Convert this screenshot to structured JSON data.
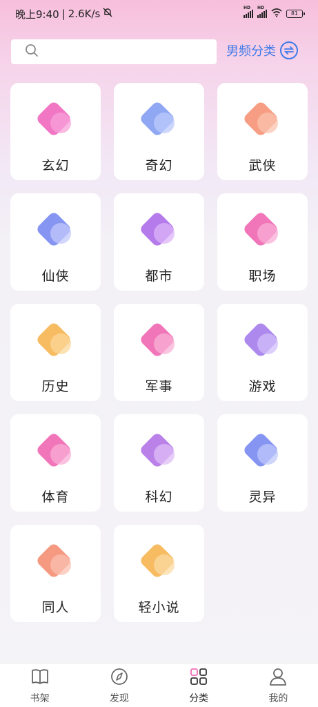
{
  "status_bar": {
    "time": "晚上9:40",
    "network_speed": "2.6K/s",
    "battery": "81",
    "signal_label": "HD"
  },
  "search": {
    "placeholder": "",
    "value": ""
  },
  "category_switch": {
    "label": "男频分类"
  },
  "categories": [
    {
      "label": "玄幻",
      "icon": "fantasy-icon",
      "color_a": "#f06fc0",
      "color_b": "#f8a2d9"
    },
    {
      "label": "奇幻",
      "icon": "magic-ball-icon",
      "color_a": "#8aa3f2",
      "color_b": "#bcc9fb"
    },
    {
      "label": "武侠",
      "icon": "martial-arts-icon",
      "color_a": "#f6987c",
      "color_b": "#fbc3ad"
    },
    {
      "label": "仙侠",
      "icon": "xianxia-icon",
      "color_a": "#7f8ff1",
      "color_b": "#c2c8fb"
    },
    {
      "label": "都市",
      "icon": "city-icon",
      "color_a": "#b174ea",
      "color_b": "#dcb4f8"
    },
    {
      "label": "职场",
      "icon": "workplace-icon",
      "color_a": "#f06fb5",
      "color_b": "#f8aed6"
    },
    {
      "label": "历史",
      "icon": "history-flag-icon",
      "color_a": "#f7b85a",
      "color_b": "#fbd79a"
    },
    {
      "label": "军事",
      "icon": "military-icon",
      "color_a": "#f06fb5",
      "color_b": "#f8b1d6"
    },
    {
      "label": "游戏",
      "icon": "gamepad-icon",
      "color_a": "#a983ec",
      "color_b": "#d2bff9"
    },
    {
      "label": "体育",
      "icon": "sports-icon",
      "color_a": "#f06fb5",
      "color_b": "#f8aed6"
    },
    {
      "label": "科幻",
      "icon": "scifi-planet-icon",
      "color_a": "#b67ae8",
      "color_b": "#ddbdf7"
    },
    {
      "label": "灵异",
      "icon": "ghost-icon",
      "color_a": "#7f8ff1",
      "color_b": "#bfc8fb"
    },
    {
      "label": "同人",
      "icon": "fan-fiction-icon",
      "color_a": "#f6937a",
      "color_b": "#fbc0b0"
    },
    {
      "label": "轻小说",
      "icon": "light-novel-icon",
      "color_a": "#f7b85a",
      "color_b": "#fbd9a2"
    }
  ],
  "tabbar": [
    {
      "label": "书架",
      "icon": "bookshelf-icon",
      "active": false
    },
    {
      "label": "发现",
      "icon": "compass-icon",
      "active": false
    },
    {
      "label": "分类",
      "icon": "category-grid-icon",
      "active": true
    },
    {
      "label": "我的",
      "icon": "profile-icon",
      "active": false
    }
  ],
  "colors": {
    "accent": "#3f7ae8",
    "tab_active_pink": "#f06fb5"
  }
}
